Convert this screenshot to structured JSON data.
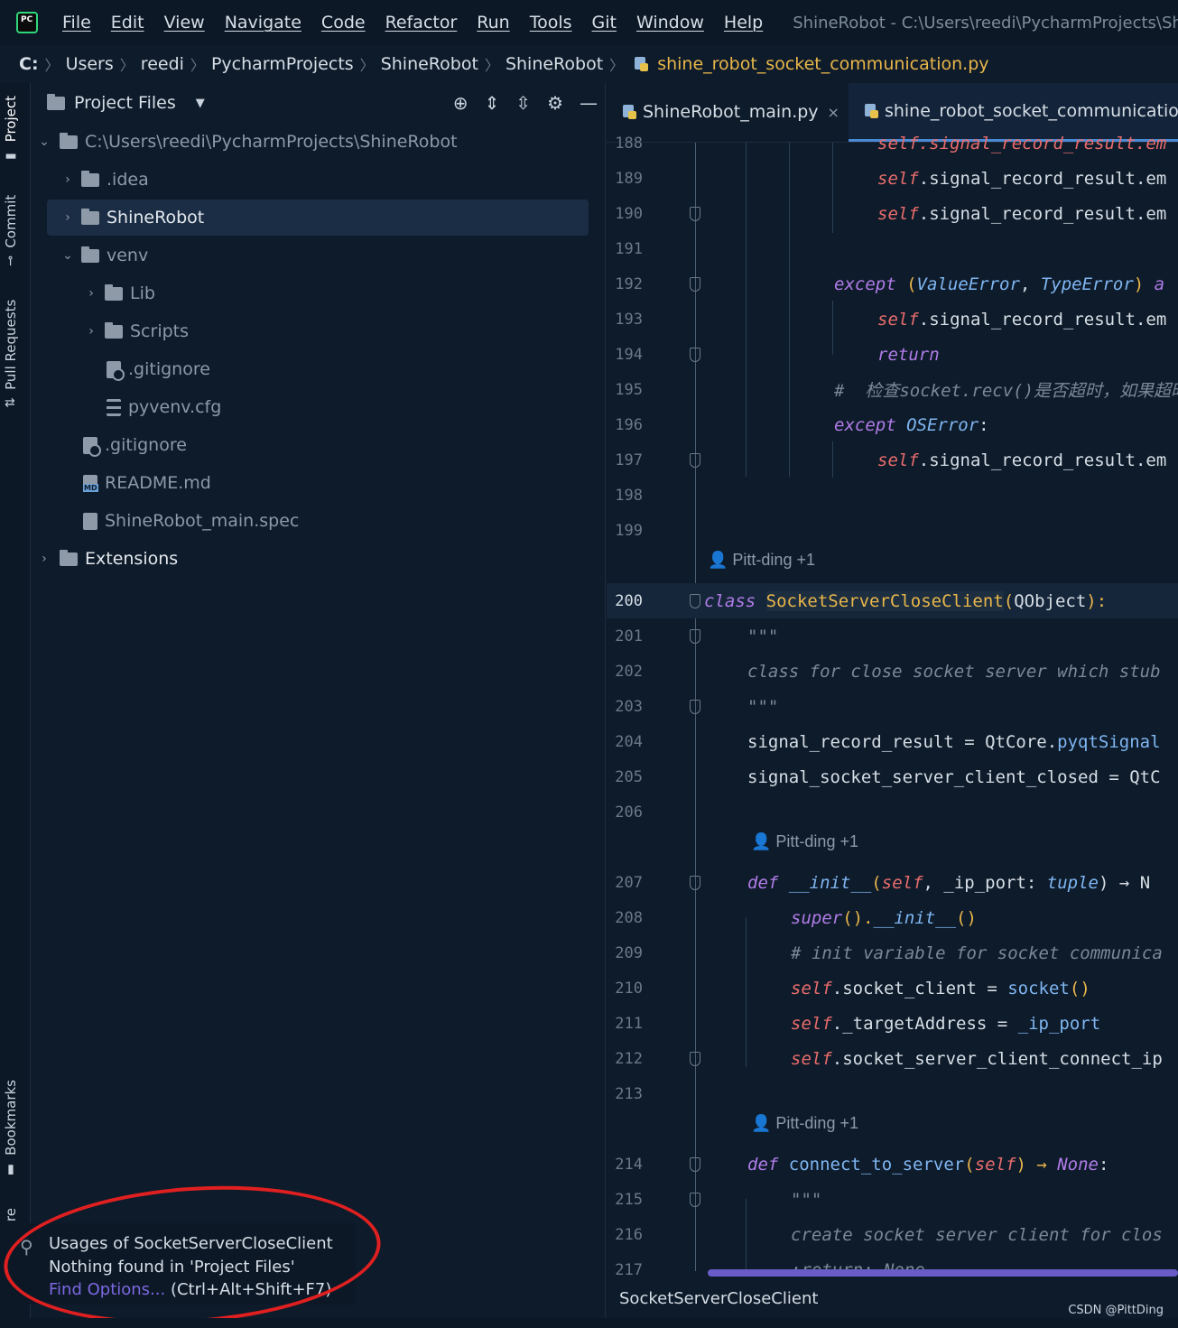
{
  "menubar": {
    "items": [
      "File",
      "Edit",
      "View",
      "Navigate",
      "Code",
      "Refactor",
      "Run",
      "Tools",
      "Git",
      "Window",
      "Help"
    ],
    "window_title": "ShineRobot - C:\\Users\\reedi\\PycharmProjects\\Shin"
  },
  "breadcrumb": [
    "C:",
    "Users",
    "reedi",
    "PycharmProjects",
    "ShineRobot",
    "ShineRobot",
    "shine_robot_socket_communication.py"
  ],
  "left_strip": {
    "project": "Project",
    "commit": "Commit",
    "pull_requests": "Pull Requests",
    "bookmarks": "Bookmarks",
    "structure": "re"
  },
  "project_panel": {
    "title": "Project Files",
    "tree": [
      {
        "label": "C:\\Users\\reedi\\PycharmProjects\\ShineRobot",
        "arrow": "⌄"
      },
      {
        "label": ".idea",
        "arrow": "›"
      },
      {
        "label": "ShineRobot",
        "arrow": "›"
      },
      {
        "label": "venv",
        "arrow": "⌄"
      },
      {
        "label": "Lib",
        "arrow": "›"
      },
      {
        "label": "Scripts",
        "arrow": "›"
      },
      {
        "label": ".gitignore"
      },
      {
        "label": "pyvenv.cfg"
      },
      {
        "label": ".gitignore"
      },
      {
        "label": "README.md"
      },
      {
        "label": "ShineRobot_main.spec"
      },
      {
        "label": "Extensions",
        "arrow": "›"
      }
    ]
  },
  "editor": {
    "tabs": [
      {
        "label": "ShineRobot_main.py",
        "close": "×"
      },
      {
        "label": "shine_robot_socket_communication.py"
      }
    ],
    "line_numbers": [
      "188",
      "189",
      "190",
      "191",
      "192",
      "193",
      "194",
      "195",
      "196",
      "197",
      "198",
      "199",
      "200",
      "201",
      "202",
      "203",
      "204",
      "205",
      "206",
      "207",
      "208",
      "209",
      "210",
      "211",
      "212",
      "213",
      "214",
      "215",
      "216",
      "217"
    ],
    "code": {
      "l188": "self.signal_record_result.em",
      "l189_self": "self",
      "l189_rest": ".signal_record_result.em",
      "l190_self": "self",
      "l190_rest": ".signal_record_result.em",
      "l192_kw": "except",
      "l192_p1": " (",
      "l192_t1": "ValueError",
      "l192_p2": ", ",
      "l192_t2": "TypeError",
      "l192_p3": ") ",
      "l192_kw2": "a",
      "l193_self": "self",
      "l193_rest": ".signal_record_result.em",
      "l194": "return",
      "l195": "#  检查socket.recv()是否超时，如果超时",
      "l196_kw": "except",
      "l196_t": " OSError",
      "l196_p": ":",
      "l197_self": "self",
      "l197_rest": ".signal_record_result.em",
      "author": "Pitt-ding +1",
      "l200_kw": "class",
      "l200_cls": "SocketServerCloseClient",
      "l200_p1": "(",
      "l200_base": "QObject",
      "l200_p2": "):",
      "l201": "\"\"\"",
      "l202": "class for close socket server which stub",
      "l203": "\"\"\"",
      "l204_a": "signal_record_result = QtCore.",
      "l204_b": "pyqtSignal",
      "l205": "signal_socket_server_client_closed = QtC",
      "l207_kw": "def",
      "l207_fn": "__init__",
      "l207_p1": "(",
      "l207_self": "self",
      "l207_p2": ", _ip_port: ",
      "l207_ty": "tuple",
      "l207_p3": ") → N",
      "l208_fn": "super",
      "l208_p1": "().",
      "l208_fn2": "__init__",
      "l208_p2": "()",
      "l209": "# init variable for socket communica",
      "l210_self": "self",
      "l210_a": ".socket_client = ",
      "l210_fn": "socket",
      "l210_b": "()",
      "l211_self": "self",
      "l211_a": "._targetAddress = ",
      "l211_b": "_ip_port",
      "l212_self": "self",
      "l212_a": ".socket_server_client_connect_ip",
      "l214_kw": "def",
      "l214_fn": "connect_to_server",
      "l214_p1": "(",
      "l214_self": "self",
      "l214_p2": ") → ",
      "l214_none": "None",
      "l214_p3": ":",
      "l215": "\"\"\"",
      "l216": "create socket server client for clos",
      "l217": ":return: None"
    },
    "status_word": "SocketServerCloseClient"
  },
  "popup": {
    "line1": "Usages of SocketServerCloseClient",
    "line2": "Nothing found in 'Project Files'",
    "link": "Find Options...",
    "shortcut": " (Ctrl+Alt+Shift+F7)"
  },
  "watermark": "CSDN @PittDing",
  "colors": {
    "annotation": "#e02020",
    "accent": "#4a8ad4"
  }
}
